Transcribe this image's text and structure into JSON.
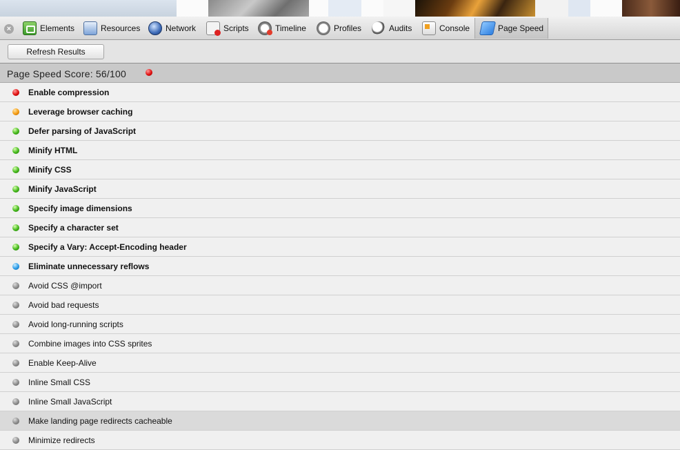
{
  "toolbar": {
    "tabs": [
      {
        "label": "Elements",
        "icon": "elements-icon"
      },
      {
        "label": "Resources",
        "icon": "resources-icon"
      },
      {
        "label": "Network",
        "icon": "network-icon"
      },
      {
        "label": "Scripts",
        "icon": "scripts-icon"
      },
      {
        "label": "Timeline",
        "icon": "timeline-icon"
      },
      {
        "label": "Profiles",
        "icon": "profiles-icon"
      },
      {
        "label": "Audits",
        "icon": "audits-icon"
      },
      {
        "label": "Console",
        "icon": "console-icon"
      },
      {
        "label": "Page Speed",
        "icon": "page-speed-icon",
        "active": true
      }
    ]
  },
  "actions": {
    "refresh_label": "Refresh Results"
  },
  "score": {
    "text": "Page Speed Score: 56/100",
    "status": "red"
  },
  "status_colors": {
    "red": "#e01010",
    "orange": "#f59a10",
    "green": "#43b81a",
    "blue": "#2a9be8",
    "gray": "#8c8c8c"
  },
  "rules": [
    {
      "label": "Enable compression",
      "status": "red",
      "bold": true
    },
    {
      "label": "Leverage browser caching",
      "status": "orange",
      "bold": true
    },
    {
      "label": "Defer parsing of JavaScript",
      "status": "green",
      "bold": true
    },
    {
      "label": "Minify HTML",
      "status": "green",
      "bold": true
    },
    {
      "label": "Minify CSS",
      "status": "green",
      "bold": true
    },
    {
      "label": "Minify JavaScript",
      "status": "green",
      "bold": true
    },
    {
      "label": "Specify image dimensions",
      "status": "green",
      "bold": true
    },
    {
      "label": "Specify a character set",
      "status": "green",
      "bold": true
    },
    {
      "label": "Specify a Vary: Accept-Encoding header",
      "status": "green",
      "bold": true
    },
    {
      "label": "Eliminate unnecessary reflows",
      "status": "blue",
      "bold": true
    },
    {
      "label": "Avoid CSS @import",
      "status": "gray",
      "bold": false
    },
    {
      "label": "Avoid bad requests",
      "status": "gray",
      "bold": false
    },
    {
      "label": "Avoid long-running scripts",
      "status": "gray",
      "bold": false
    },
    {
      "label": "Combine images into CSS sprites",
      "status": "gray",
      "bold": false
    },
    {
      "label": "Enable Keep-Alive",
      "status": "gray",
      "bold": false
    },
    {
      "label": "Inline Small CSS",
      "status": "gray",
      "bold": false
    },
    {
      "label": "Inline Small JavaScript",
      "status": "gray",
      "bold": false
    },
    {
      "label": "Make landing page redirects cacheable",
      "status": "gray",
      "bold": false,
      "highlighted": true
    },
    {
      "label": "Minimize redirects",
      "status": "gray",
      "bold": false
    }
  ]
}
